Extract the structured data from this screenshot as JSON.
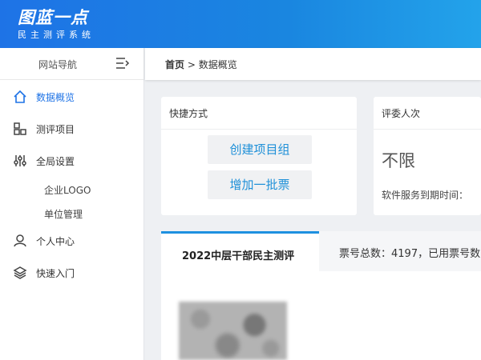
{
  "header": {
    "logo_title": "图蓝一点",
    "logo_subtitle": "民主测评系统"
  },
  "sidebar": {
    "nav_title": "网站导航",
    "items": [
      {
        "label": "数据概览",
        "icon": "home-icon",
        "active": true
      },
      {
        "label": "测评项目",
        "icon": "grid-icon"
      },
      {
        "label": "全局设置",
        "icon": "sliders-icon"
      },
      {
        "label": "个人中心",
        "icon": "user-icon"
      },
      {
        "label": "快速入门",
        "icon": "layers-icon"
      }
    ],
    "sub_items": [
      {
        "label": "企业LOGO"
      },
      {
        "label": "单位管理"
      }
    ]
  },
  "breadcrumb": {
    "home": "首页",
    "separator": ">",
    "current": "数据概览"
  },
  "shortcut_card": {
    "title": "快捷方式",
    "buttons": [
      {
        "label": "创建项目组"
      },
      {
        "label": "增加一批票"
      }
    ]
  },
  "reviewers_card": {
    "title": "评委人次",
    "value": "不限",
    "expire_label": "软件服务到期时间："
  },
  "tabs": [
    {
      "label": "2022中层干部民主测评"
    }
  ],
  "ticket_info": "票号总数：4197，已用票号数",
  "colors": {
    "accent": "#1e73e6",
    "button_text": "#1e90d8"
  }
}
